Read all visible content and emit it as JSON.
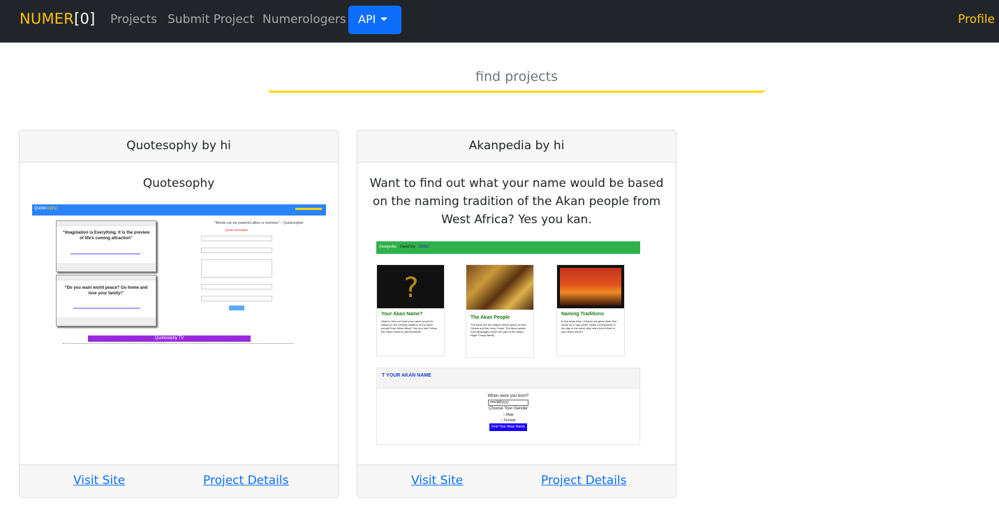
{
  "navbar": {
    "brand_main": "NUMER",
    "brand_suffix": "[0]",
    "links": [
      "Projects",
      "Submit Project",
      "Numerologers"
    ],
    "api_label": "API",
    "profile_label": "Profile"
  },
  "search": {
    "placeholder": "find projects"
  },
  "projects": [
    {
      "header": "Quotesophy by hi",
      "description": "Quotesophy",
      "visit_label": "Visit Site",
      "details_label": "Project Details",
      "preview": {
        "brand_a": "Quote",
        "brand_b": "sophy",
        "quote1": "“Imagination is Everything. It is the preview of life's coming attraction”",
        "quote2": "“Do you want world peace? Go home and love your family!”",
        "side_quote": "“Words can be powerful allies or enemies” – Quotesopher",
        "form_title": "Quote Generator",
        "tv_label": "Quotesophy TV"
      }
    },
    {
      "header": "Akanpedia by hi",
      "description": "Want to find out what your name would be based on the naming tradition of the Akan people from West Africa? Yes you kan.",
      "visit_label": "Visit Site",
      "details_label": "Project Details",
      "preview": {
        "nav": "Akanpedia",
        "nav2": "OsekCity",
        "nav3": "Hello!",
        "cards": [
          {
            "title": "Your Akan Name?",
            "text": "Want to find out what your name would be based on the naming tradition of the Akan people from West Africa? Yes you kan Follow the steps below to get Akanised!"
          },
          {
            "title": "The Akan People",
            "text": "The Akan are the largest ethnic group in both Ghana and the Ivory Coast. The Akan speak Kwa languages which are part of the larger Niger-Congo family."
          },
          {
            "title": "Naming Traditions",
            "text": "In the Akan tribe, children are given their first name as a 'day name' which corresponds to the day in the week they were born.What is your Akan name?"
          }
        ],
        "form_header": "T YOUR AKAN NAME",
        "born_label": "When were you born?",
        "date_value": "mm/dd/yyyy",
        "gender_label": "Choose Your Gender",
        "male": "Male",
        "female": "Female",
        "submit": "Find Your Akan Name"
      }
    }
  ]
}
